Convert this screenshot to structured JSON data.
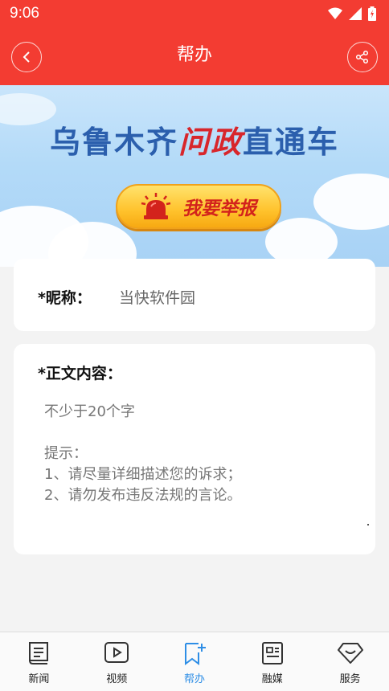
{
  "status_bar": {
    "time": "9:06"
  },
  "header": {
    "title": "帮办"
  },
  "banner": {
    "title_part1": "乌鲁木齐",
    "title_part2": "问政",
    "title_part3": "直通车",
    "report_button": "我要举报"
  },
  "form": {
    "nickname_label": "*昵称：",
    "nickname_value": "当快软件园",
    "content_label": "*正文内容：",
    "content_placeholder": "不少于20个字\n\n提示：\n1、请尽量详细描述您的诉求；\n2、请勿发布违反法规的言论。"
  },
  "tabs": [
    {
      "label": "新闻",
      "icon": "news-icon"
    },
    {
      "label": "视频",
      "icon": "video-icon"
    },
    {
      "label": "帮办",
      "icon": "help-icon",
      "active": true
    },
    {
      "label": "融媒",
      "icon": "media-icon"
    },
    {
      "label": "服务",
      "icon": "service-icon"
    }
  ],
  "colors": {
    "primary_red": "#f33c32",
    "active_tab": "#2e8ee6",
    "banner_blue": "#2b5fad"
  }
}
